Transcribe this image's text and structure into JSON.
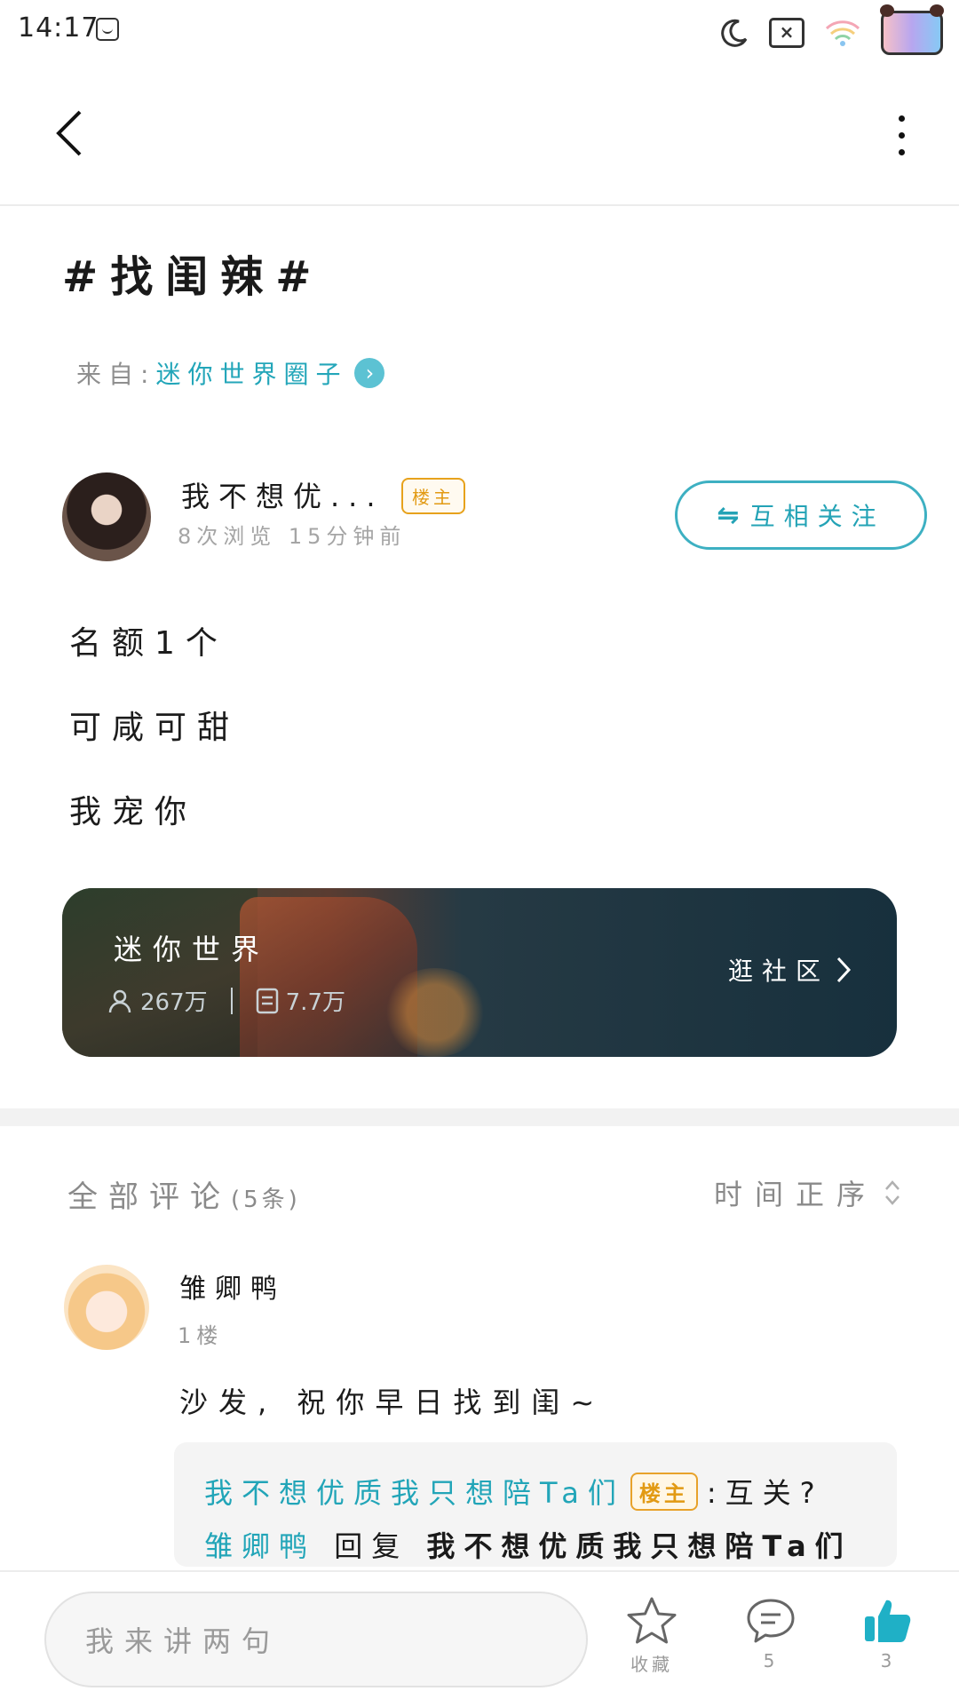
{
  "status_bar": {
    "time": "14:17"
  },
  "post": {
    "title": "#找闺辣#",
    "from_label": "来自:",
    "from_circle": "迷你世界圈子",
    "author": {
      "name": "我不想优...",
      "badge": "楼主",
      "meta": "8次浏览 15分钟前"
    },
    "follow_button": "互相关注",
    "body": [
      "名额1个",
      "可咸可甜",
      "我宠你"
    ]
  },
  "community_card": {
    "title": "迷你世界",
    "members": "267万",
    "posts": "7.7万",
    "action": "逛社区"
  },
  "comments": {
    "title": "全部评论",
    "count": "(5条)",
    "sort_label": "时间正序",
    "items": [
      {
        "name": "雏卿鸭",
        "floor": "1楼",
        "text": "沙发, 祝你早日找到闺~",
        "replies": [
          {
            "author": "我不想优质我只想陪Ta们",
            "badge": "楼主",
            "text": ":互关?"
          },
          {
            "author": "雏卿鸭",
            "verb": "回复",
            "target": "我不想优质我只想陪Ta们"
          }
        ]
      }
    ]
  },
  "bottom_bar": {
    "input_placeholder": "我来讲两句",
    "favorite_label": "收藏",
    "comment_count": "5",
    "like_count": "3"
  },
  "colors": {
    "accent": "#22a5b8",
    "badge": "#e29a13"
  },
  "icons": [
    "back-icon",
    "more-icon",
    "moon-icon",
    "wifi-icon",
    "follow-swap-icon",
    "user-icon",
    "document-icon",
    "chevron-right-icon",
    "sort-icon",
    "star-icon",
    "chat-icon",
    "thumbs-up-icon"
  ]
}
